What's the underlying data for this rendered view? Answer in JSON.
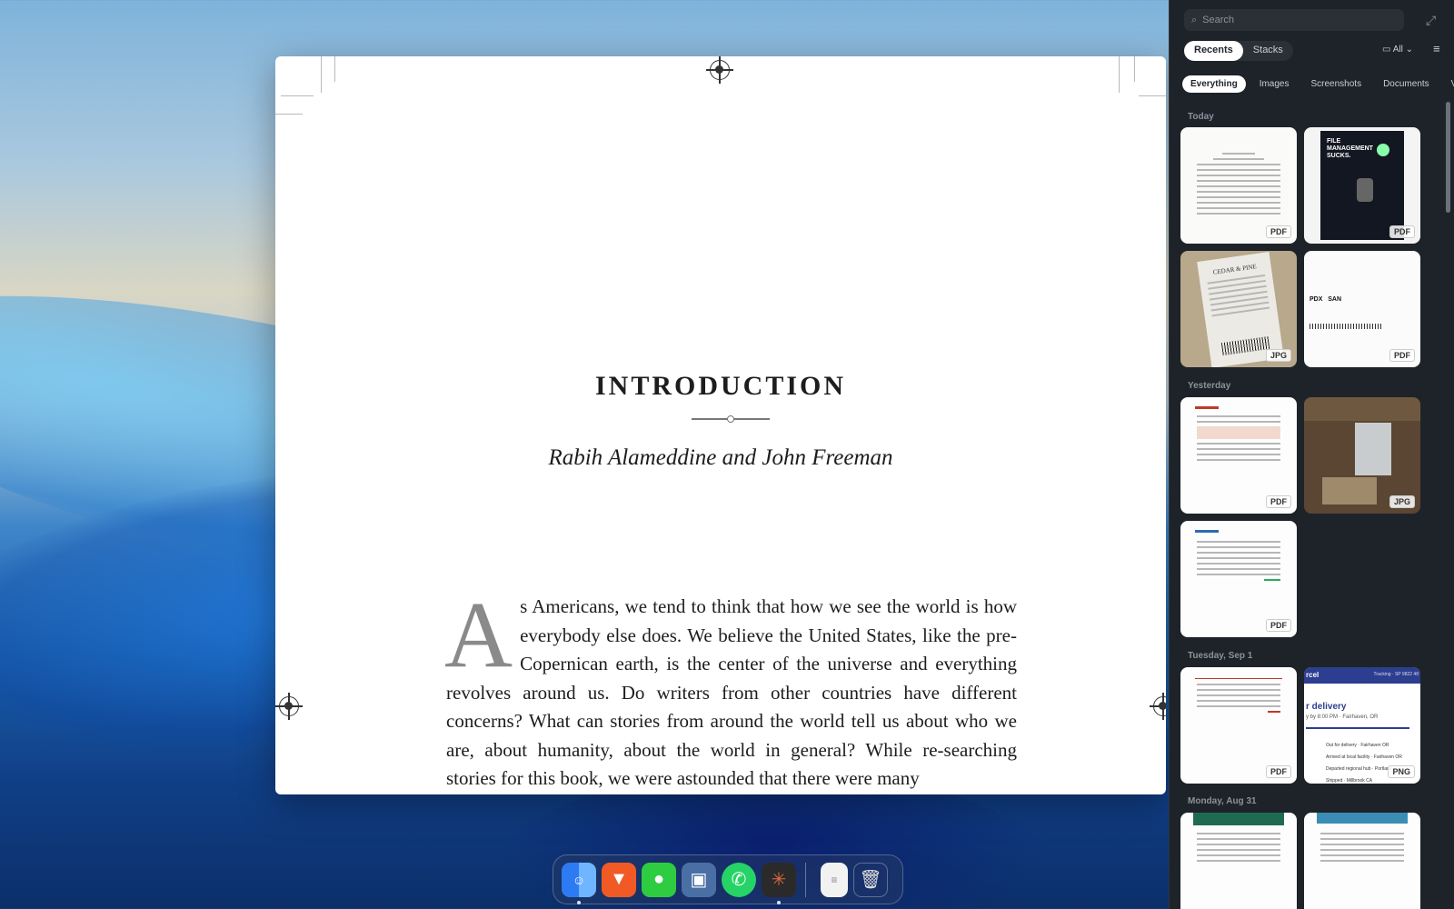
{
  "document": {
    "title": "INTRODUCTION",
    "authors": "Rabih Alameddine and John Freeman",
    "drop_cap": "A",
    "body": "s Americans, we tend to think that how we see the world is how everybody else does. We believe the United States, like the pre-Copernican earth, is the center of the universe and everything revolves around us. Do writers from other countries have different concerns? What can stories from around the world tell us about who we are, about humanity, about the world in general? While re-searching stories for this book, we were astounded that there were many"
  },
  "dock": {
    "apps": [
      "finder-icon",
      "brave-icon",
      "messages-icon",
      "preview-icon",
      "whatsapp-icon",
      "claude-icon"
    ],
    "extras": [
      "document-icon",
      "trash-icon"
    ]
  },
  "sidebar": {
    "search_placeholder": "Search",
    "tabs": [
      {
        "label": "Recents",
        "selected": true
      },
      {
        "label": "Stacks",
        "selected": false
      }
    ],
    "all_label": "All",
    "filters": [
      {
        "label": "Everything",
        "selected": true
      },
      {
        "label": "Images",
        "selected": false
      },
      {
        "label": "Screenshots",
        "selected": false
      },
      {
        "label": "Documents",
        "selected": false
      },
      {
        "label": "Vid",
        "selected": false
      }
    ],
    "sections": [
      {
        "label": "Today",
        "items": [
          {
            "badge": "PDF"
          },
          {
            "badge": "PDF"
          },
          {
            "badge": "JPG"
          },
          {
            "badge": "PDF"
          }
        ]
      },
      {
        "label": "Yesterday",
        "items": [
          {
            "badge": "PDF"
          },
          {
            "badge": "JPG"
          },
          {
            "badge": "PDF"
          }
        ]
      },
      {
        "label": "Tuesday, Sep 1",
        "items": [
          {
            "badge": "PDF"
          },
          {
            "badge": "PNG"
          }
        ]
      },
      {
        "label": "Monday, Aug 31",
        "items": [
          {
            "badge": ""
          },
          {
            "badge": ""
          }
        ]
      }
    ],
    "thumb_text": {
      "file_mgmt": "FILE MANAGEMENT SUCKS.",
      "receipt": "CEDAR & PINE",
      "ticket_from": "PDX",
      "ticket_to": "SAN",
      "delivery": "r delivery",
      "delivery_sub": "y by 8:00 PM · Fairhaven, OR",
      "tracking": "Tracking · SP 9822 48",
      "rcel": "rcel",
      "status1": "Out for delivery · Fairhaven OR",
      "status2": "Arrived at local facility · Fairhaven OR",
      "status3": "Departed regional hub · Portland",
      "status4": "Shipped · Millbrook CA"
    }
  }
}
